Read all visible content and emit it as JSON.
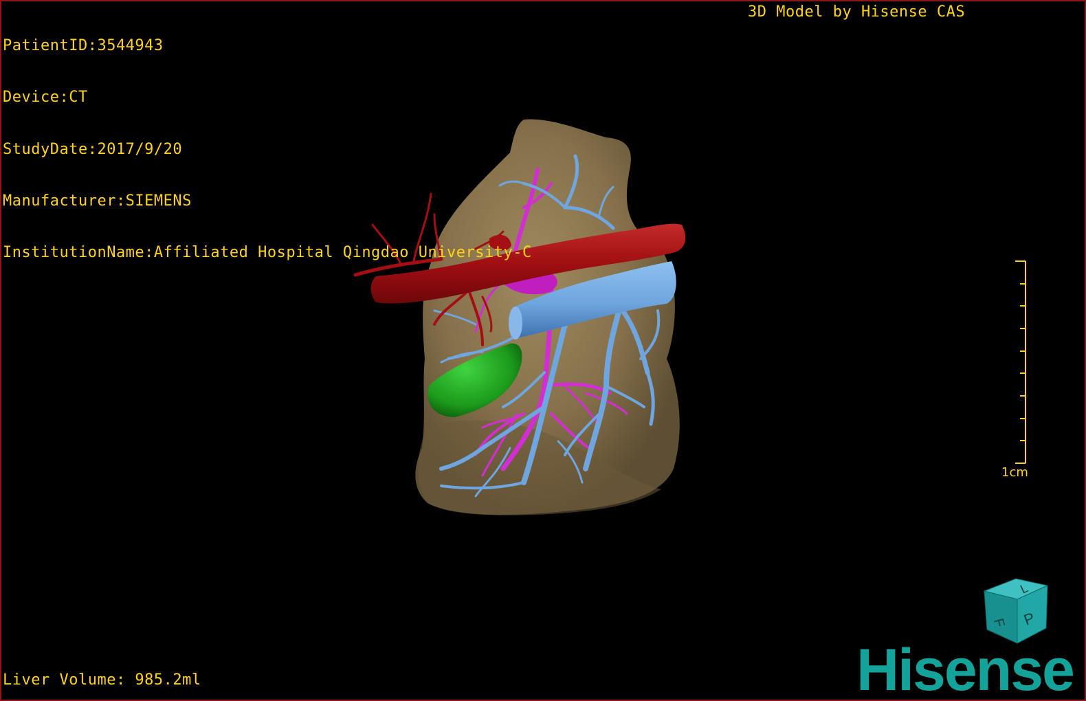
{
  "patient_info": {
    "patient_id": "PatientID:3544943",
    "device": "Device:CT",
    "study_date": "StudyDate:2017/9/20",
    "manufacturer": "Manufacturer:SIEMENS",
    "institution": "InstitutionName:Affiliated Hospital Qingdao University-C"
  },
  "model_credit": "3D Model by Hisense CAS",
  "liver_volume": "Liver Volume: 985.2ml",
  "scale_bar": {
    "label": "1cm",
    "tick_count": 10
  },
  "orientation_cube": {
    "face_front": "P",
    "face_left": "F",
    "face_top": "L"
  },
  "logo": "Hisense",
  "colors": {
    "overlay_text": "#ffd21f",
    "liver": "#8c7550",
    "hepatic_artery": "#a30f12",
    "portal_vein": "#6fa6e0",
    "hepatic_vein": "#d22fd2",
    "gallbladder": "#1fa51f",
    "brand": "#14a39a"
  }
}
